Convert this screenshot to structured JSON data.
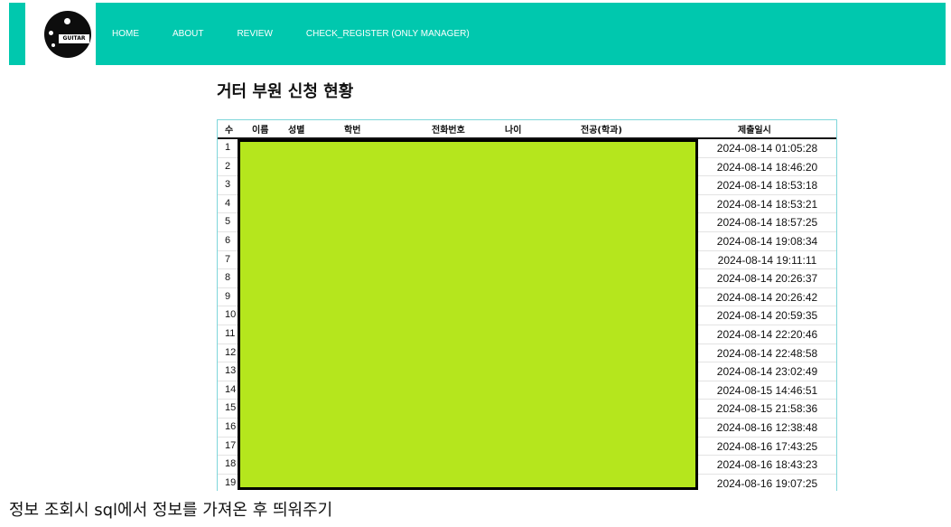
{
  "nav": {
    "logo_text": "GUITAR",
    "links": [
      "HOME",
      "ABOUT",
      "REVIEW",
      "CHECK_REGISTER (ONLY MANAGER)"
    ]
  },
  "page": {
    "title": "거터 부원 신청 현황"
  },
  "table": {
    "headers": [
      "수",
      "이름",
      "성별",
      "학번",
      "전화번호",
      "나이",
      "전공(학과)",
      "제출일시"
    ],
    "rows": [
      {
        "num": "1",
        "date": "2024-08-14 01:05:28"
      },
      {
        "num": "2",
        "date": "2024-08-14 18:46:20"
      },
      {
        "num": "3",
        "date": "2024-08-14 18:53:18"
      },
      {
        "num": "4",
        "date": "2024-08-14 18:53:21"
      },
      {
        "num": "5",
        "date": "2024-08-14 18:57:25"
      },
      {
        "num": "6",
        "date": "2024-08-14 19:08:34"
      },
      {
        "num": "7",
        "date": "2024-08-14 19:11:11"
      },
      {
        "num": "8",
        "date": "2024-08-14 20:26:37"
      },
      {
        "num": "9",
        "date": "2024-08-14 20:26:42"
      },
      {
        "num": "10",
        "date": "2024-08-14 20:59:35"
      },
      {
        "num": "11",
        "date": "2024-08-14 22:20:46"
      },
      {
        "num": "12",
        "date": "2024-08-14 22:48:58"
      },
      {
        "num": "13",
        "date": "2024-08-14 23:02:49"
      },
      {
        "num": "14",
        "date": "2024-08-15 14:46:51"
      },
      {
        "num": "15",
        "date": "2024-08-15 21:58:36"
      },
      {
        "num": "16",
        "date": "2024-08-16 12:38:48"
      },
      {
        "num": "17",
        "date": "2024-08-16 17:43:25"
      },
      {
        "num": "18",
        "date": "2024-08-16 18:43:23"
      },
      {
        "num": "19",
        "date": "2024-08-16 19:07:25"
      }
    ]
  },
  "caption": "정보 조회시 sql에서 정보를 가져온 후 띄워주기",
  "colors": {
    "nav_bg": "#00c8ae",
    "redaction": "#b5e61d",
    "table_border": "#7fd6da"
  }
}
